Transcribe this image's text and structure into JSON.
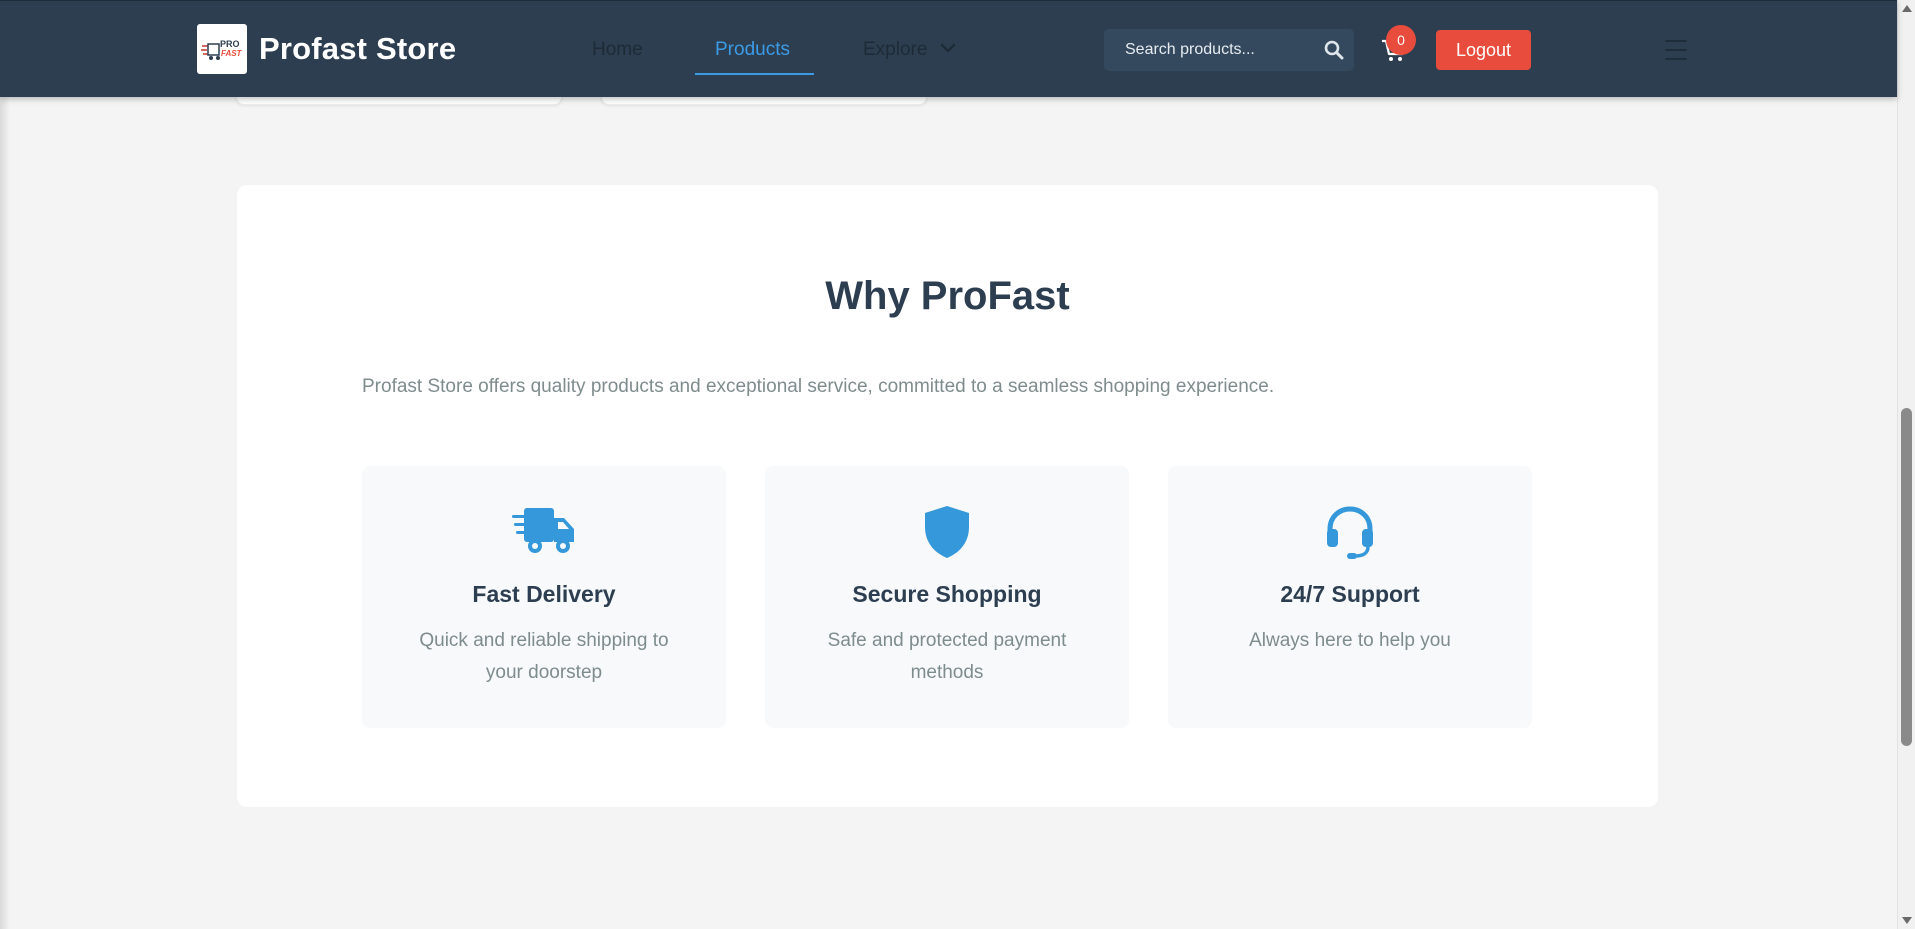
{
  "header": {
    "brand": "Profast Store",
    "logo_text_top": "PRO",
    "logo_text_bottom": "FAST",
    "nav": {
      "home": "Home",
      "products": "Products",
      "explore": "Explore"
    },
    "active_nav": "Products",
    "search": {
      "placeholder": "Search products...",
      "value": ""
    },
    "cart_count": "0",
    "logout_label": "Logout"
  },
  "why_section": {
    "title": "Why ProFast",
    "description": "Profast Store offers quality products and exceptional service, committed to a seamless shopping experience.",
    "features": [
      {
        "icon": "truck-icon",
        "title": "Fast Delivery",
        "description": "Quick and reliable shipping to your doorstep"
      },
      {
        "icon": "shield-icon",
        "title": "Secure Shopping",
        "description": "Safe and protected payment methods"
      },
      {
        "icon": "headset-icon",
        "title": "24/7 Support",
        "description": "Always here to help you"
      }
    ]
  },
  "colors": {
    "header_bg": "#2c3e50",
    "accent_blue": "#3498db",
    "logout_red": "#e74c3c",
    "page_bg": "#f4f4f4"
  }
}
